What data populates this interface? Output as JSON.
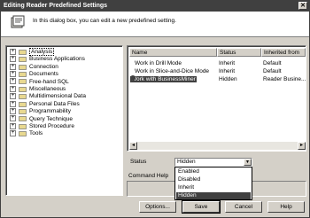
{
  "window": {
    "title": "Editing Reader Predefined Settings",
    "close_glyph": "✕"
  },
  "header": {
    "description": "In this dialog box, you can edit a new predefined setting.",
    "icon": "settings-icon"
  },
  "tree": {
    "items": [
      {
        "label": "Analysis",
        "selected": true
      },
      {
        "label": "Business Applications"
      },
      {
        "label": "Connection"
      },
      {
        "label": "Documents"
      },
      {
        "label": "Free-hand SQL"
      },
      {
        "label": "Miscellaneous"
      },
      {
        "label": "Multidimensional Data"
      },
      {
        "label": "Personal Data Files"
      },
      {
        "label": "Programmability"
      },
      {
        "label": "Query Technique"
      },
      {
        "label": "Stored Procedure"
      },
      {
        "label": "Tools"
      }
    ],
    "expand_glyph": "+"
  },
  "settings_list": {
    "columns": [
      "Name",
      "Status",
      "Inherited from"
    ],
    "rows": [
      {
        "name": "Work in Drill Mode",
        "status": "Inherit",
        "inherited": "Default",
        "selected": false
      },
      {
        "name": "Work in Slice-and-Dice Mode",
        "status": "Inherit",
        "inherited": "Default",
        "selected": false
      },
      {
        "name": "Work with BusinessMiner",
        "status": "Hidden",
        "inherited": "Reader Busine...",
        "selected": true
      }
    ],
    "scroll_left": "◂",
    "scroll_right": "▸"
  },
  "status": {
    "label": "Status",
    "value": "Hidden",
    "arrow": "▼",
    "options": [
      {
        "label": "Enabled"
      },
      {
        "label": "Disabled"
      },
      {
        "label": "Inherit"
      },
      {
        "label": "Hidden",
        "selected": true
      }
    ]
  },
  "command_help": {
    "label": "Command Help"
  },
  "buttons": {
    "options": "Options...",
    "save": "Save",
    "cancel": "Cancel",
    "help": "Help"
  },
  "colors": {
    "dialog_bg": "#d4d0c8",
    "selection": "#404040",
    "folder": "#e8d890"
  }
}
